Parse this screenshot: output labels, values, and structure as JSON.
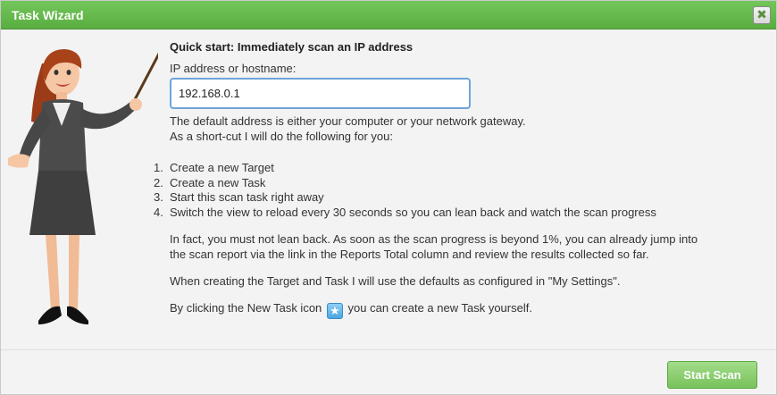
{
  "dialog": {
    "title": "Task Wizard",
    "close_glyph": "✖",
    "close_icon": "close-icon"
  },
  "main": {
    "heading": "Quick start: Immediately scan an IP address",
    "ip_label": "IP address or hostname:",
    "ip_value": "192.168.0.1",
    "default_note_line1": "The default address is either your computer or your network gateway.",
    "default_note_line2": "As a short-cut I will do the following for you:",
    "steps": [
      {
        "num": "1.",
        "text": "Create a new Target"
      },
      {
        "num": "2.",
        "text": "Create a new Task"
      },
      {
        "num": "3.",
        "text": "Start this scan task right away"
      },
      {
        "num": "4.",
        "text": "Switch the view to reload every 30 seconds so you can lean back and watch the scan progress"
      }
    ],
    "lean_back_line1": "In fact, you must not lean back. As soon as the scan progress is beyond 1%, you can already jump into",
    "lean_back_line2": "the scan report via the link in the Reports Total column and review the results collected so far.",
    "defaults_note": "When creating the Target and Task I will use the defaults as configured in \"My Settings\".",
    "new_task_before": "By clicking the New Task icon",
    "new_task_after": "you can create a new Task yourself.",
    "new_task_icon": "star-icon",
    "new_task_glyph": "★"
  },
  "footer": {
    "start_scan_label": "Start Scan"
  },
  "colors": {
    "titlebar": "#5aad41",
    "button": "#78c25c",
    "input_border": "#6ea5d9"
  }
}
